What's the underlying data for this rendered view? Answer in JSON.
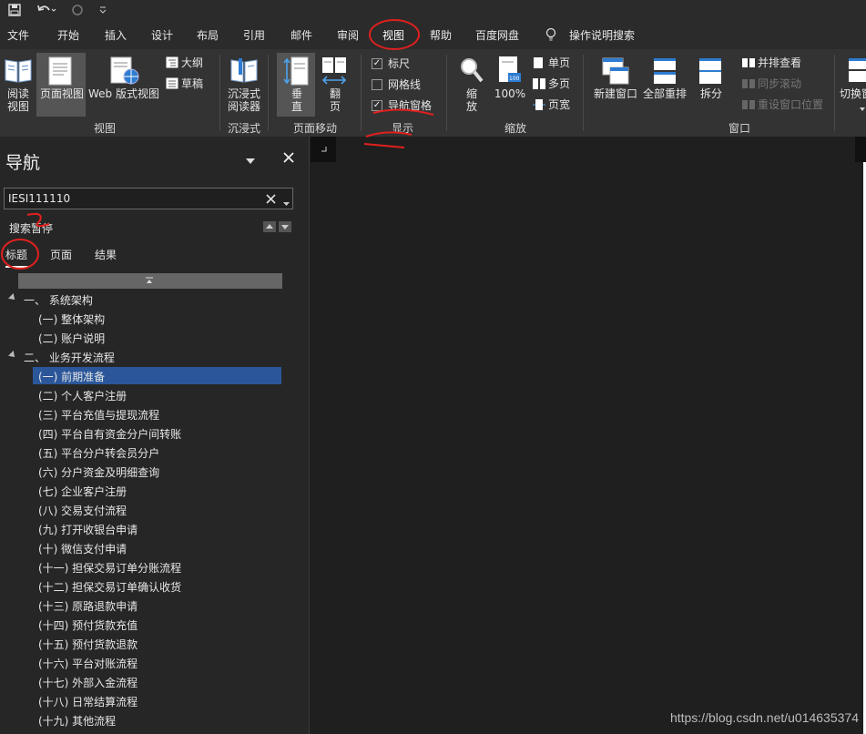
{
  "menu": {
    "tabs": [
      "文件",
      "开始",
      "插入",
      "设计",
      "布局",
      "引用",
      "邮件",
      "审阅",
      "视图",
      "帮助",
      "百度网盘"
    ],
    "tell_me": "操作说明搜索"
  },
  "ribbon": {
    "read_view": "阅读\n视图",
    "print_layout": "页面视图",
    "web_layout": "Web 版式视图",
    "outline": "大纲",
    "draft": "草稿",
    "group_views": "视图",
    "immersive_reader": "沉浸式\n阅读器",
    "group_immersive": "沉浸式",
    "vertical": "垂\n直",
    "side_to_side": "翻\n页",
    "group_page_movement": "页面移动",
    "ruler": "标尺",
    "gridlines": "网格线",
    "nav_pane": "导航窗格",
    "group_show": "显示",
    "zoom": "缩\n放",
    "zoom_100": "100%",
    "one_page": "单页",
    "multiple_pages": "多页",
    "page_width": "页宽",
    "group_zoom": "缩放",
    "new_window": "新建窗口",
    "arrange_all": "全部重排",
    "split": "拆分",
    "view_side_by_side": "并排查看",
    "sync_scrolling": "同步滚动",
    "reset_window_position": "重设窗口位置",
    "group_window": "窗口",
    "switch_windows": "切换窗"
  },
  "nav": {
    "title": "导航",
    "search_value": "IESI111110",
    "search_results_label": "搜索暂停",
    "tabs": [
      "标题",
      "页面",
      "结果"
    ],
    "headings": [
      {
        "text": "一、 系统架构",
        "level": 1
      },
      {
        "text": "(一) 整体架构",
        "level": 2
      },
      {
        "text": "(二) 账户说明",
        "level": 2
      },
      {
        "text": "二、 业务开发流程",
        "level": 1
      },
      {
        "text": "(一) 前期准备",
        "level": 2,
        "selected": true
      },
      {
        "text": "(二) 个人客户注册",
        "level": 2
      },
      {
        "text": "(三) 平台充值与提现流程",
        "level": 2
      },
      {
        "text": "(四) 平台自有资金分户间转账",
        "level": 2
      },
      {
        "text": "(五) 平台分户转会员分户",
        "level": 2
      },
      {
        "text": "(六) 分户资金及明细查询",
        "level": 2
      },
      {
        "text": "(七) 企业客户注册",
        "level": 2
      },
      {
        "text": "(八) 交易支付流程",
        "level": 2
      },
      {
        "text": "(九) 打开收银台申请",
        "level": 2
      },
      {
        "text": "(十)  微信支付申请",
        "level": 2
      },
      {
        "text": "(十一) 担保交易订单分账流程",
        "level": 2
      },
      {
        "text": "(十二) 担保交易订单确认收货",
        "level": 2
      },
      {
        "text": "(十三) 原路退款申请",
        "level": 2
      },
      {
        "text": "(十四) 预付货款充值",
        "level": 2
      },
      {
        "text": "(十五) 预付货款退款",
        "level": 2
      },
      {
        "text": "(十六) 平台对账流程",
        "level": 2
      },
      {
        "text": "(十七) 外部入金流程",
        "level": 2
      },
      {
        "text": "(十八) 日常结算流程",
        "level": 2
      },
      {
        "text": "(十九) 其他流程",
        "level": 2
      }
    ]
  },
  "watermark": "https://blog.csdn.net/u014635374",
  "colors": {
    "accent": "#2b579a",
    "annotation": "#e0201f"
  }
}
